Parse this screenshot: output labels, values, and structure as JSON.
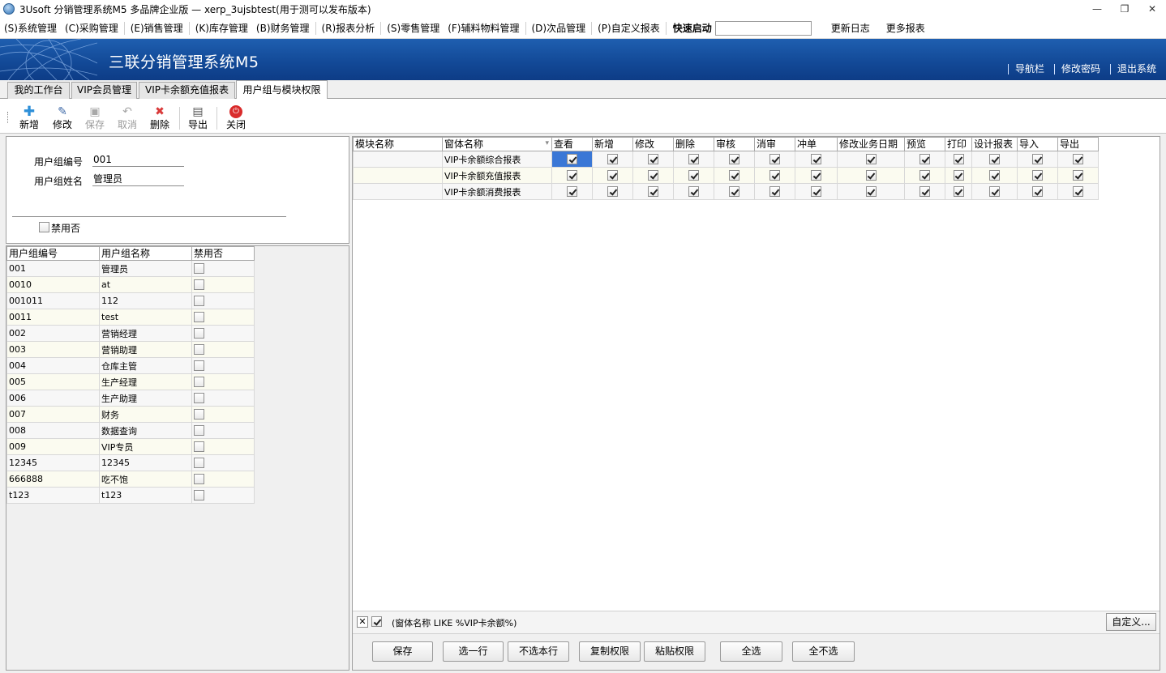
{
  "window": {
    "title": "3Usoft 分销管理系统M5 多品牌企业版 — xerp_3ujsbtest(用于测可以发布版本)",
    "minimize": "—",
    "restore": "❐",
    "close": "✕"
  },
  "menu": {
    "items": [
      "(S)系统管理",
      "(C)采购管理",
      "(E)销售管理",
      "(K)库存管理",
      "(B)财务管理",
      "(R)报表分析",
      "(S)零售管理",
      "(F)辅料物料管理",
      "(D)次品管理",
      "(P)自定义报表"
    ],
    "quick_start_label": "快速启动",
    "quick_start_value": "",
    "update_log": "更新日志",
    "more_reports": "更多报表"
  },
  "banner": {
    "title": "三联分销管理系统M5",
    "links": [
      "导航栏",
      "修改密码",
      "退出系统"
    ]
  },
  "tabs": [
    {
      "label": "我的工作台",
      "active": false
    },
    {
      "label": "VIP会员管理",
      "active": false
    },
    {
      "label": "VIP卡余额充值报表",
      "active": false
    },
    {
      "label": "用户组与模块权限",
      "active": true
    }
  ],
  "toolbar": {
    "new": "新增",
    "edit": "修改",
    "save": "保存",
    "cancel": "取消",
    "delete": "删除",
    "export": "导出",
    "close": "关闭"
  },
  "form": {
    "group_id_label": "用户组编号",
    "group_id_value": "001",
    "group_name_label": "用户组姓名",
    "group_name_value": "管理员",
    "disabled_label": "禁用否"
  },
  "group_table": {
    "headers": [
      "用户组编号",
      "用户组名称",
      "禁用否"
    ],
    "rows": [
      {
        "id": "001",
        "name": "管理员",
        "disabled": false
      },
      {
        "id": "0010",
        "name": "at",
        "disabled": false
      },
      {
        "id": "001011",
        "name": "112",
        "disabled": false
      },
      {
        "id": "0011",
        "name": "test",
        "disabled": false
      },
      {
        "id": "002",
        "name": "营销经理",
        "disabled": false
      },
      {
        "id": "003",
        "name": "营销助理",
        "disabled": false
      },
      {
        "id": "004",
        "name": "仓库主管",
        "disabled": false
      },
      {
        "id": "005",
        "name": "生产经理",
        "disabled": false
      },
      {
        "id": "006",
        "name": "生产助理",
        "disabled": false
      },
      {
        "id": "007",
        "name": "财务",
        "disabled": false
      },
      {
        "id": "008",
        "name": "数据查询",
        "disabled": false
      },
      {
        "id": "009",
        "name": "VIP专员",
        "disabled": false
      },
      {
        "id": "12345",
        "name": "12345",
        "disabled": false
      },
      {
        "id": "666888",
        "name": "吃不饱",
        "disabled": false
      },
      {
        "id": "t123",
        "name": "t123",
        "disabled": false
      }
    ]
  },
  "perm_table": {
    "headers": [
      "模块名称",
      "窗体名称",
      "查看",
      "新增",
      "修改",
      "删除",
      "审核",
      "消审",
      "冲单",
      "修改业务日期",
      "预览",
      "打印",
      "设计报表",
      "导入",
      "导出"
    ],
    "rows": [
      {
        "module": "",
        "form": "VIP卡余额综合报表",
        "perms": [
          true,
          true,
          true,
          true,
          true,
          true,
          true,
          true,
          true,
          true,
          true,
          true,
          true
        ]
      },
      {
        "module": "",
        "form": "VIP卡余额充值报表",
        "perms": [
          true,
          true,
          true,
          true,
          true,
          true,
          true,
          true,
          true,
          true,
          true,
          true,
          true
        ]
      },
      {
        "module": "",
        "form": "VIP卡余额消费报表",
        "perms": [
          true,
          true,
          true,
          true,
          true,
          true,
          true,
          true,
          true,
          true,
          true,
          true,
          true
        ]
      }
    ]
  },
  "filter": {
    "text": "(窗体名称 LIKE %VIP卡余额%)",
    "enabled": true,
    "custom_button": "自定义..."
  },
  "buttons": {
    "save": "保存",
    "select_row": "选一行",
    "unselect_row": "不选本行",
    "copy_perm": "复制权限",
    "paste_perm": "粘贴权限",
    "select_all": "全选",
    "select_none": "全不选"
  }
}
